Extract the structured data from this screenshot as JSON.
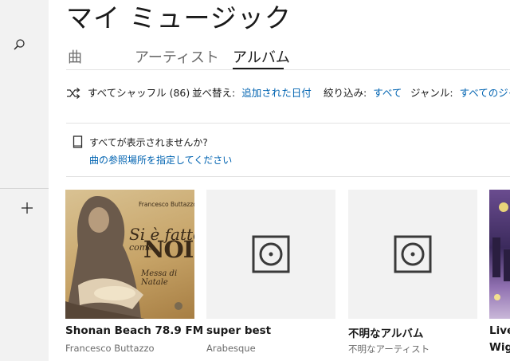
{
  "page": {
    "title": "マイ ミュージック"
  },
  "tabs": [
    {
      "label": "曲"
    },
    {
      "label": "アーティスト"
    },
    {
      "label": "アルバム"
    }
  ],
  "toolbar": {
    "shuffle_label": "すべてシャッフル (86)",
    "sort_label": "並べ替え:",
    "sort_value": "追加された日付",
    "filter_label": "絞り込み:",
    "filter_value": "すべて",
    "genre_label": "ジャンル:",
    "genre_value": "すべてのジャンル"
  },
  "notice": {
    "question": "すべてが表示されませんか?",
    "link": "曲の参照場所を指定してください"
  },
  "albums": [
    {
      "title": "Shonan Beach 78.9 FM",
      "artist": "Francesco Buttazzo",
      "cover": {
        "author": "Francesco Buttazzo",
        "title_line": "Si è fatto",
        "come": "come",
        "noi": "NOI",
        "subtitle": "Messa di Natale"
      }
    },
    {
      "title": "super best",
      "artist": "Arabesque"
    },
    {
      "title": "不明なアルバム",
      "artist": "不明なアーティスト"
    },
    {
      "title": "Live",
      "artist": "Wig"
    }
  ],
  "icons": {
    "sidebar_search": "search-icon",
    "sidebar_add": "plus-icon",
    "shuffle": "shuffle-icon",
    "notice": "document-icon",
    "placeholder": "album-placeholder-icon"
  },
  "colors": {
    "accent": "#0063b1",
    "sidebar_bg": "#f2f2f2",
    "placeholder_bg": "#f2f2f2",
    "icon": "#3a3a3a"
  }
}
